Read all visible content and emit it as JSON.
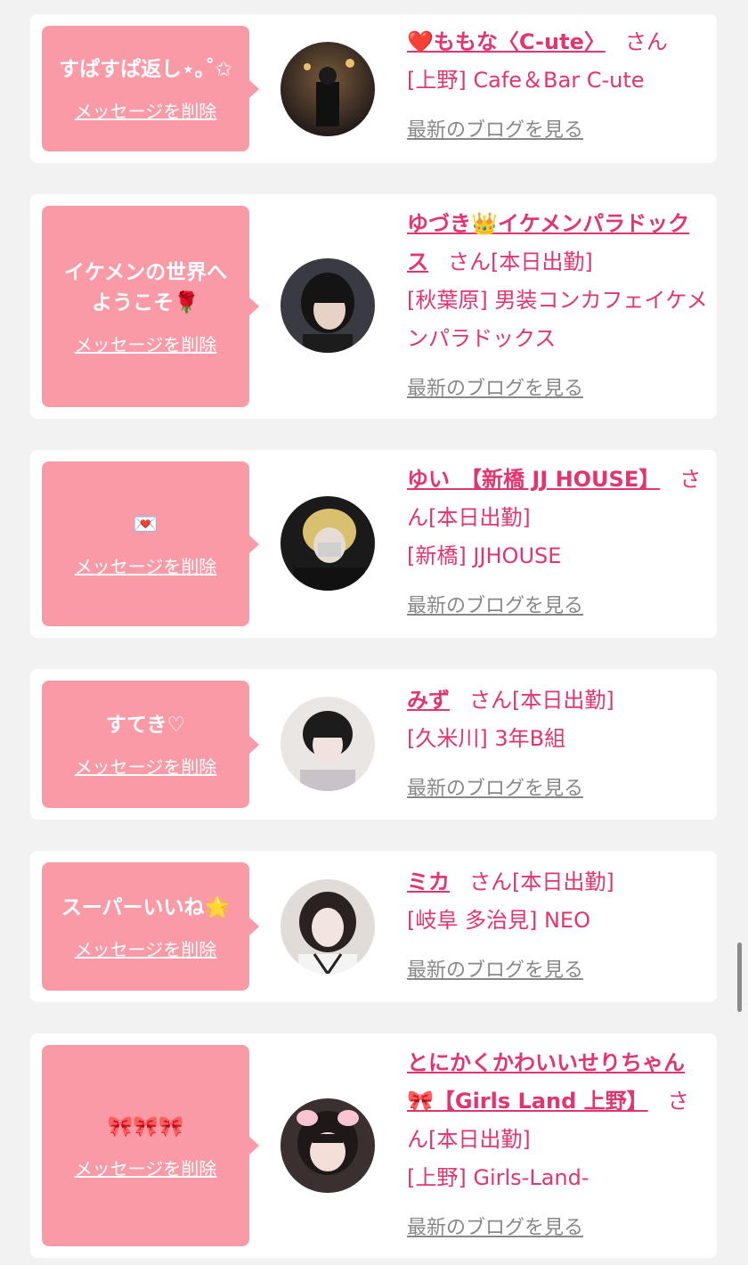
{
  "items": [
    {
      "message": "すぱすぱ返し⋆｡˚✩",
      "delete_label": "メッセージを削除",
      "name": "❤️ももな〈C-ute〉",
      "honorific": "さん",
      "status": "",
      "shop": "[上野] Cafe＆Bar C-ute",
      "blog_label": "最新のブログを見る"
    },
    {
      "message": "イケメンの世界へ\nようこそ🌹",
      "delete_label": "メッセージを削除",
      "name": "ゆづき👑イケメンパラドックス",
      "honorific": "さん",
      "status": "[本日出勤]",
      "shop": "[秋葉原] 男装コンカフェイケメンパラドックス",
      "blog_label": "最新のブログを見る"
    },
    {
      "message": "💌",
      "delete_label": "メッセージを削除",
      "name": "ゆい　【新橋 JJ HOUSE】",
      "honorific": "さん",
      "status": "[本日出勤]",
      "shop": "[新橋] JJHOUSE",
      "blog_label": "最新のブログを見る"
    },
    {
      "message": "すてき♡",
      "delete_label": "メッセージを削除",
      "name": "みず",
      "honorific": "さん",
      "status": "[本日出勤]",
      "shop": "[久米川] 3年B組",
      "blog_label": "最新のブログを見る"
    },
    {
      "message": "スーパーいいね🌟",
      "delete_label": "メッセージを削除",
      "name": "ミカ",
      "honorific": "さん",
      "status": "[本日出勤]",
      "shop": "[岐阜 多治見] NEO",
      "blog_label": "最新のブログを見る"
    },
    {
      "message": "🎀🎀🎀",
      "delete_label": "メッセージを削除",
      "name": "とにかくかわいいせりちゃん🎀【Girls Land 上野】",
      "honorific": "さん",
      "status": "[本日出勤]",
      "shop": "[上野] Girls-Land-",
      "blog_label": "最新のブログを見る"
    }
  ],
  "colors": {
    "accent": "#e2356f",
    "bubble": "#fa9aa6",
    "link_gray": "#888888",
    "page_bg": "#f2f2f2"
  }
}
